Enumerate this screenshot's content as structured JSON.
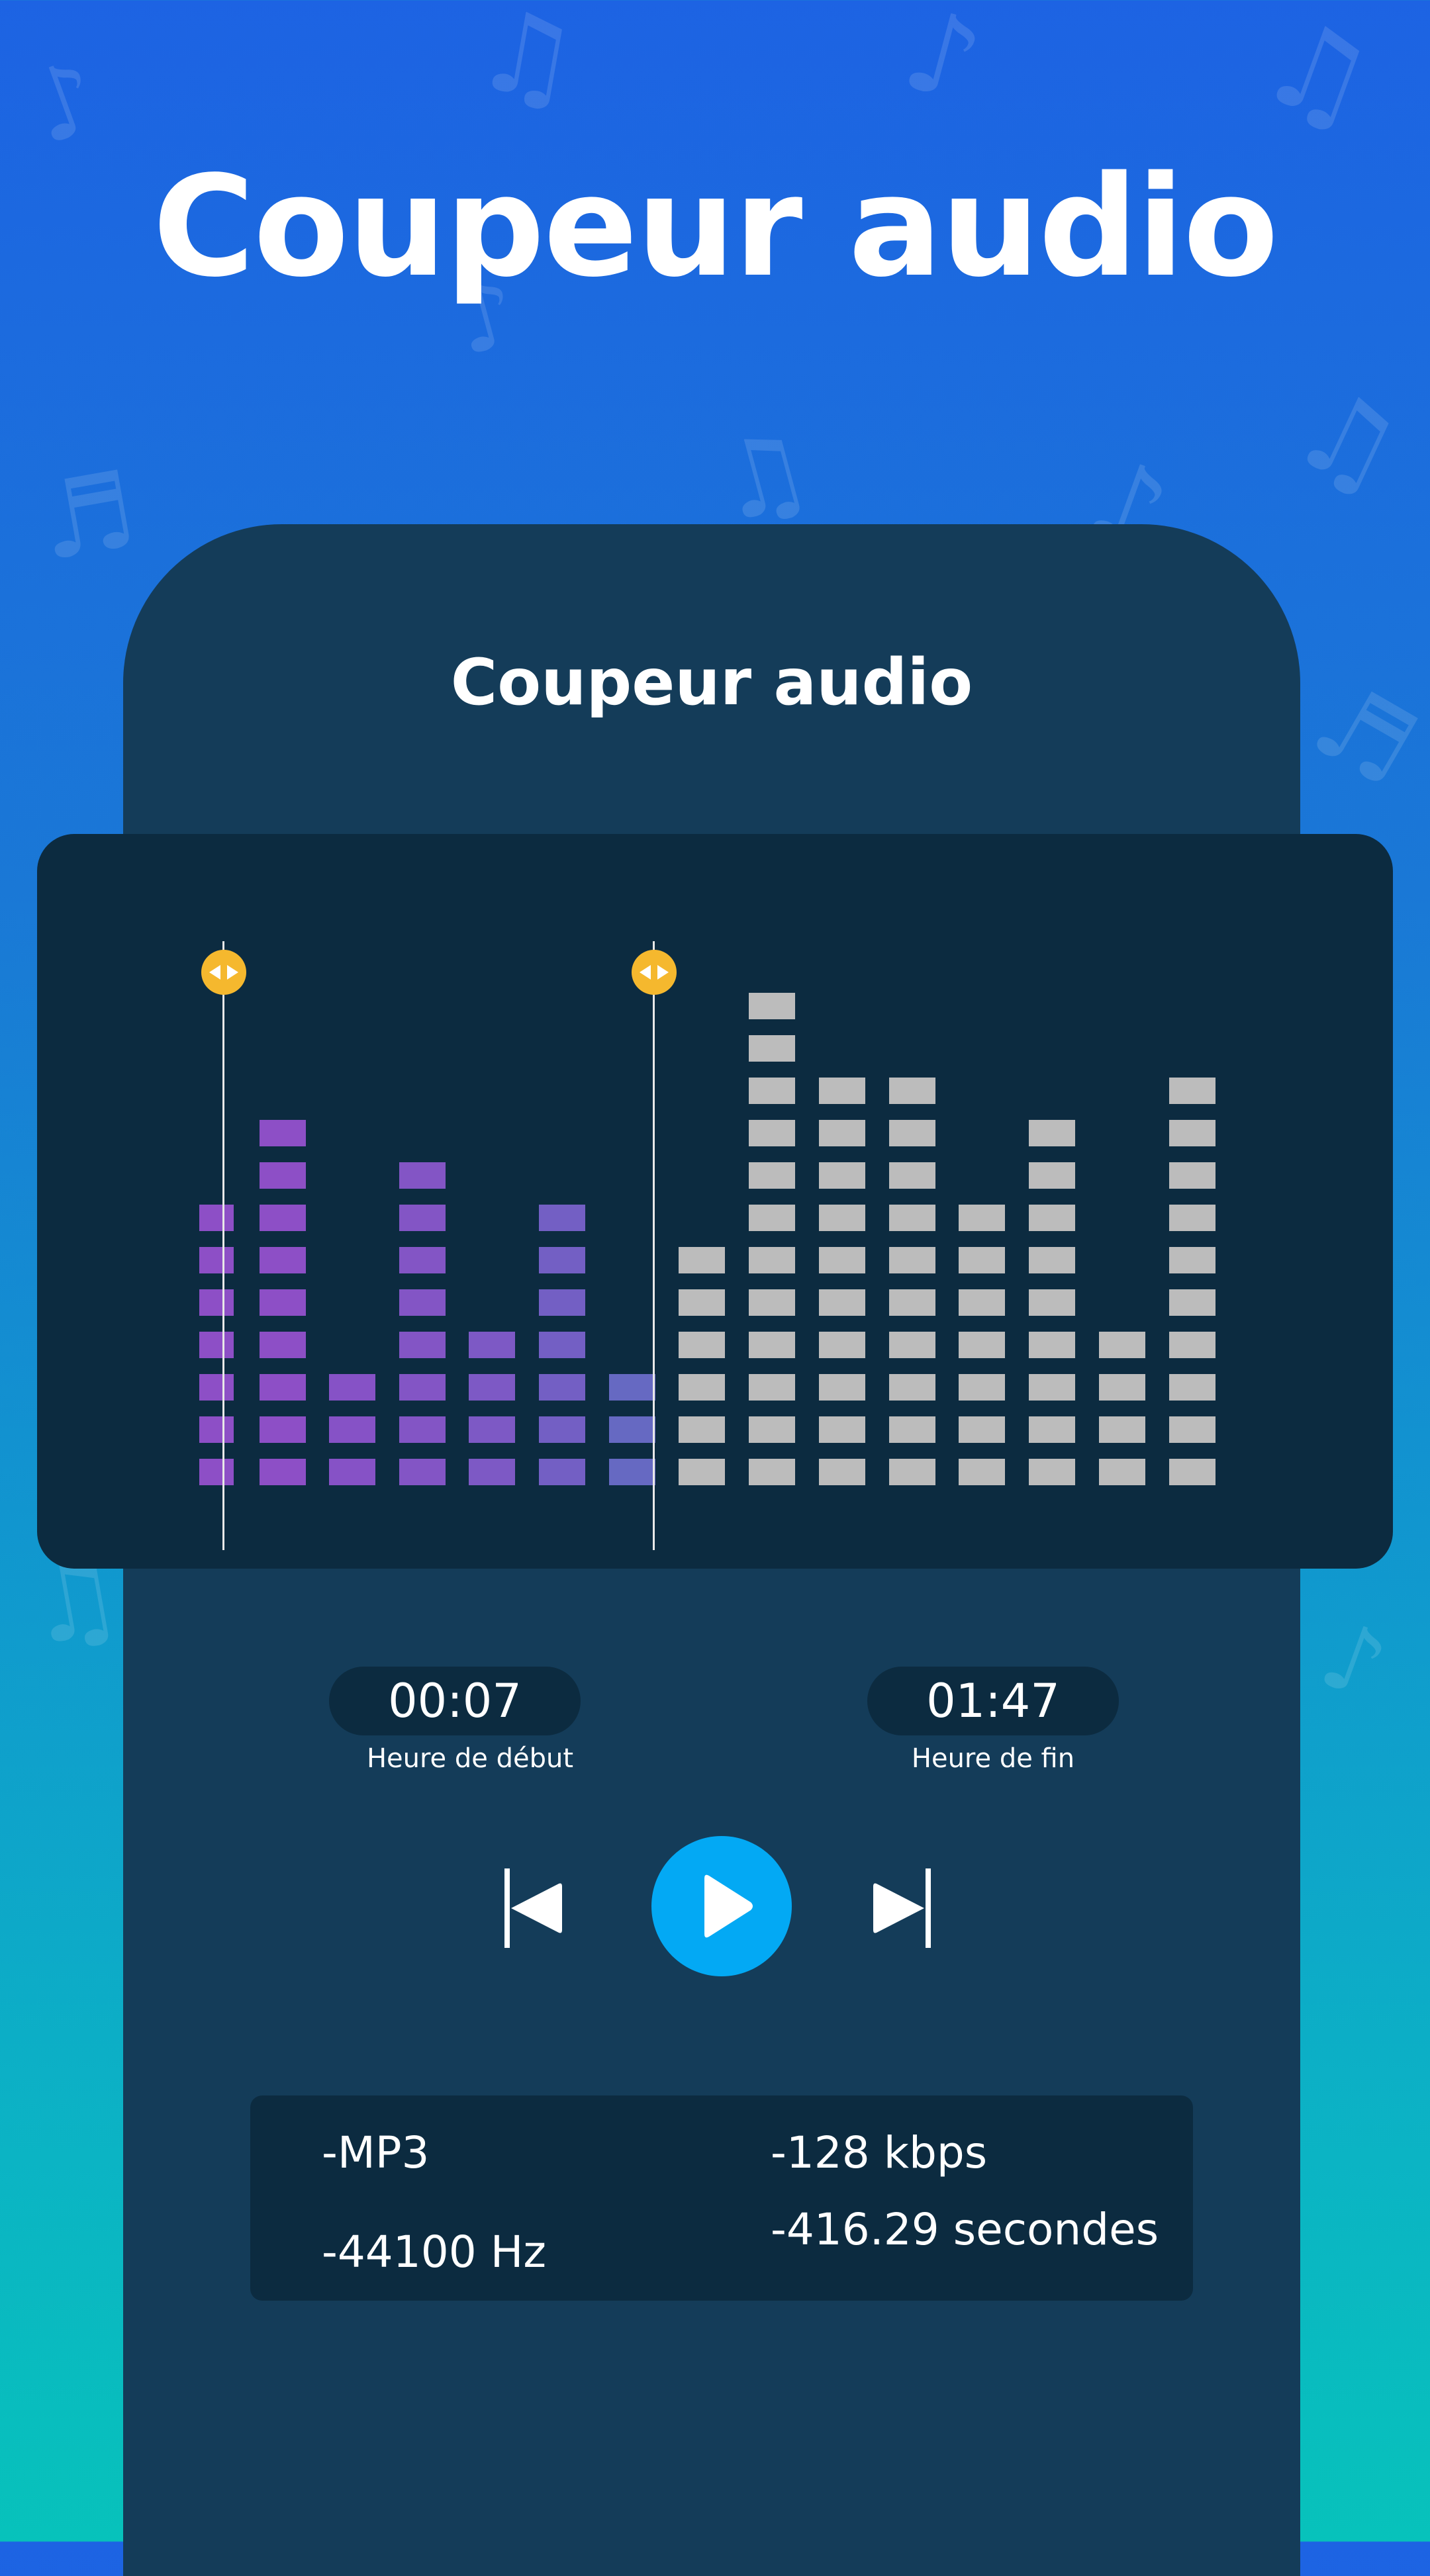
{
  "headline": "Coupeur audio",
  "screen": {
    "title": "Coupeur audio"
  },
  "trim": {
    "start_time": "00:07",
    "start_label": "Heure de début",
    "end_time": "01:47",
    "end_label": "Heure de fin"
  },
  "controls": {
    "previous_icon": "skip-to-start-icon",
    "play_icon": "play-icon",
    "next_icon": "skip-to-end-icon"
  },
  "info": {
    "format": "-MP3",
    "bitrate": "-128 kbps",
    "sample_rate": "-44100 Hz",
    "duration": "-416.29 secondes"
  },
  "colors": {
    "background_top": "#1d63e3",
    "background_bottom": "#07c2bb",
    "phone": "#143c59",
    "panel": "#0c2b40",
    "play_button": "#03a9f4",
    "handle": "#f5b82e",
    "selected_bar": "#8d4fc6",
    "unselected_bar": "#bcbcbc"
  }
}
